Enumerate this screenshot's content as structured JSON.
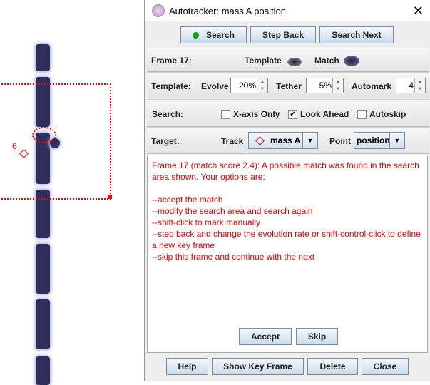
{
  "video": {
    "point_label": "6",
    "colors": {
      "marker": "#ff0000",
      "object": "#2e2f5a"
    }
  },
  "dialog": {
    "title": "Autotracker: mass A position",
    "close_icon": "close-icon",
    "toolbar": {
      "search": "Search",
      "step_back": "Step Back",
      "search_next": "Search Next"
    },
    "frame_row": {
      "frame": "Frame 17:",
      "template": "Template",
      "match": "Match"
    },
    "template_row": {
      "label": "Template:",
      "evolve_label": "Evolve",
      "evolve": "20%",
      "tether_label": "Tether",
      "tether": "5%",
      "automark_label": "Automark",
      "automark": "4"
    },
    "search_row": {
      "label": "Search:",
      "x_axis_only": "X-axis Only",
      "x_axis_checked": false,
      "look_ahead": "Look Ahead",
      "look_ahead_checked": true,
      "autoskip": "Autoskip",
      "autoskip_checked": false
    },
    "target_row": {
      "label": "Target:",
      "track_label": "Track",
      "track": "mass A",
      "point_label": "Point",
      "point": "position"
    },
    "message": [
      "Frame 17 (match score 2.4): A possible match was found in the search area shown. Your options are:",
      "",
      "--accept the match",
      "--modify the search area and search again",
      "--shift-click to mark manually",
      "--step back and change the evolution rate or shift-control-click to define a new key frame",
      "--skip this frame and continue with the next"
    ],
    "accept": "Accept",
    "skip": "Skip",
    "bottom": {
      "help": "Help",
      "show_key_frame": "Show Key Frame",
      "delete": "Delete",
      "close": "Close"
    }
  }
}
